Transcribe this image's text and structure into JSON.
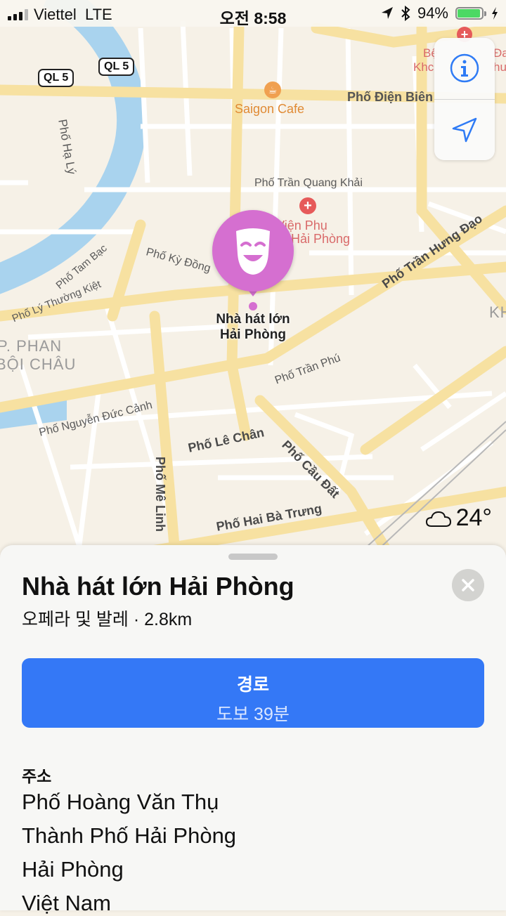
{
  "status_bar": {
    "carrier": "Viettel",
    "network": "LTE",
    "time": "오전 8:58",
    "battery_text": "94%",
    "battery_level": 0.94
  },
  "map": {
    "roads": [
      {
        "name": "QL 5"
      },
      {
        "name": "QL 5"
      },
      {
        "name": "Phố Hạ Lý"
      },
      {
        "name": "Phố Điện Biên"
      },
      {
        "name": "Phố Trần Quang Khải"
      },
      {
        "name": "Phố Trần Hưng Đạo"
      },
      {
        "name": "Phố Kỳ Đồng"
      },
      {
        "name": "Phố Tam Bạc"
      },
      {
        "name": "Phố Lý Thường Kiệt"
      },
      {
        "name": "Phố Trần Phú"
      },
      {
        "name": "Phố Nguyễn Đức Cảnh"
      },
      {
        "name": "Phố Lê Chân"
      },
      {
        "name": "Phố Cầu Đất"
      },
      {
        "name": "Phố Mê Linh"
      },
      {
        "name": "Phố Hai Bà Trưng"
      }
    ],
    "areas": {
      "area_1_line1": "P. PHAN",
      "area_1_line2": "BỘI CHÂU",
      "area_2": "KH"
    },
    "pois": {
      "cafe": "Saigon Cafe",
      "hospital_partial": "nh Viện Phụ",
      "hospital_partial_2": "Hải Phòng",
      "topright_1": "Bệ",
      "topright_2": "Khc",
      "topright_3": "Đa",
      "topright_4": "hu"
    },
    "pin": {
      "label_line1": "Nhà hát lớn",
      "label_line2": "Hải Phòng",
      "icon": "theater-mask-icon"
    },
    "weather": {
      "temperature": "24°",
      "icon": "cloud-icon"
    }
  },
  "controls": {
    "info_icon": "info-icon",
    "location_icon": "location-arrow-icon"
  },
  "sheet": {
    "title": "Nhà hát lớn Hải Phòng",
    "subtitle": "오페라 및 발레 · 2.8km",
    "route_label": "경로",
    "route_detail": "도보 39분",
    "address_heading": "주소",
    "address_lines": [
      "Phố Hoàng Văn Thụ",
      "Thành Phố Hải Phòng",
      "Hải Phòng",
      "Việt Nam"
    ]
  },
  "colors": {
    "accent": "#3478f6",
    "pin": "#d56fd0",
    "water": "#a9d3ee",
    "major_road": "#f7e1a1"
  }
}
